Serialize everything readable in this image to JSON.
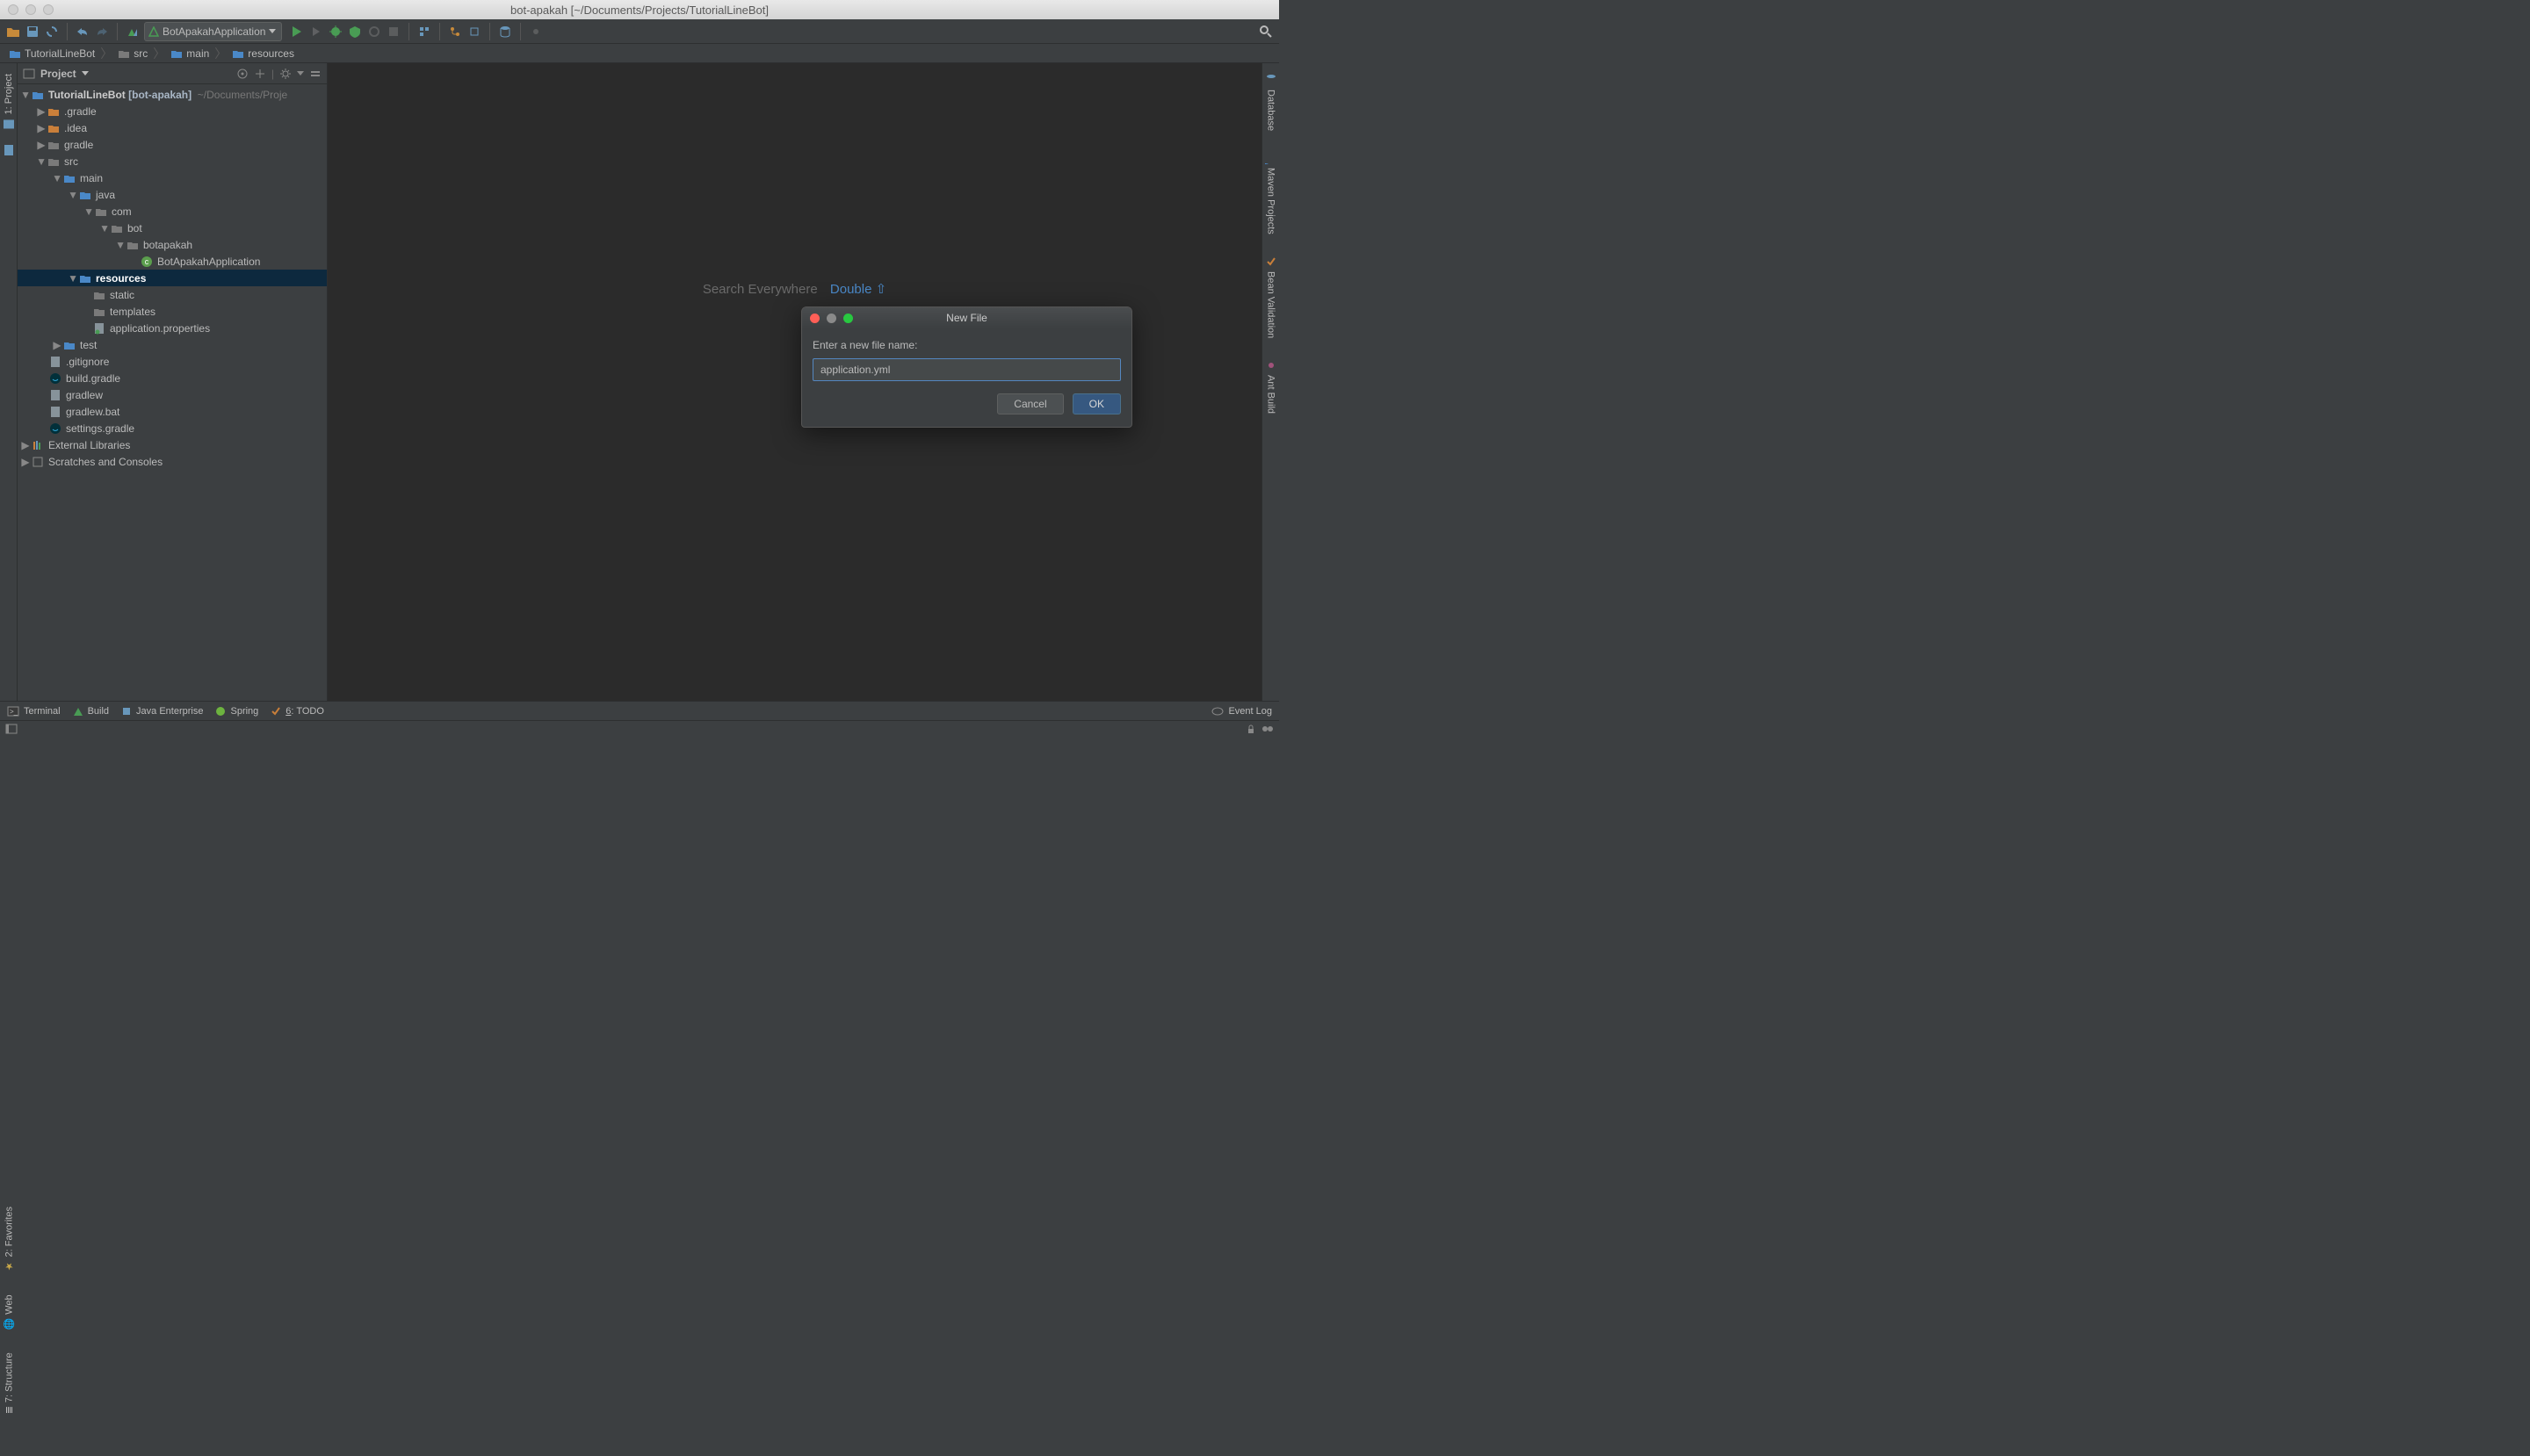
{
  "titlebar": {
    "title": "bot-apakah [~/Documents/Projects/TutorialLineBot]"
  },
  "toolbar": {
    "runConfig": "BotApakahApplication"
  },
  "breadcrumb": [
    "TutorialLineBot",
    "src",
    "main",
    "resources"
  ],
  "leftGutter": {
    "tab1": "1: Project"
  },
  "rightGutter": {
    "tab1": "Database",
    "tab2": "Maven Projects",
    "tab3": "Bean Validation",
    "tab4": "Ant Build"
  },
  "projectPanel": {
    "title": "Project"
  },
  "tree": {
    "root": {
      "name": "TutorialLineBot",
      "suffix": "[bot-apakah]",
      "path": "~/Documents/Proje"
    },
    "n_gradleHidden": ".gradle",
    "n_idea": ".idea",
    "n_gradle": "gradle",
    "n_src": "src",
    "n_main": "main",
    "n_java": "java",
    "n_com": "com",
    "n_bot": "bot",
    "n_botapakah": "botapakah",
    "n_class": "BotApakahApplication",
    "n_resources": "resources",
    "n_static": "static",
    "n_templates": "templates",
    "n_appprops": "application.properties",
    "n_test": "test",
    "n_gitignore": ".gitignore",
    "n_buildgradle": "build.gradle",
    "n_gradlew": "gradlew",
    "n_gradlewbat": "gradlew.bat",
    "n_settingsgradle": "settings.gradle",
    "n_extlib": "External Libraries",
    "n_scratches": "Scratches and Consoles"
  },
  "editorHints": {
    "hint1_label": "Search Everywhere",
    "hint1_key": "Double ⇧"
  },
  "dialog": {
    "title": "New File",
    "label": "Enter a new file name:",
    "value": "application.yml",
    "cancel": "Cancel",
    "ok": "OK"
  },
  "bottombar": {
    "terminal": "Terminal",
    "build": "Build",
    "javaee": "Java Enterprise",
    "spring": "Spring",
    "todo": "6: TODO",
    "eventlog": "Event Log"
  }
}
